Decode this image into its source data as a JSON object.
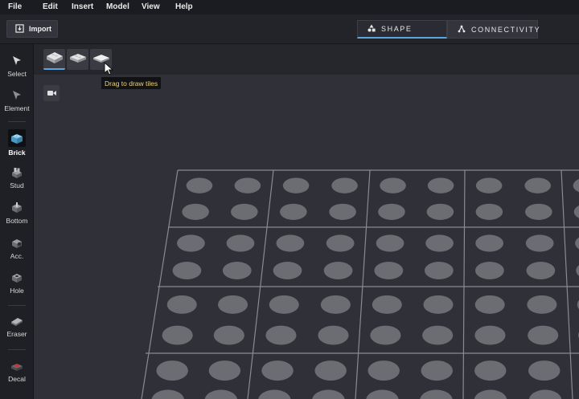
{
  "menu": [
    {
      "label": "File",
      "name": "menu-file"
    },
    {
      "label": "Edit",
      "name": "menu-edit"
    },
    {
      "label": "Insert",
      "name": "menu-insert"
    },
    {
      "label": "Model",
      "name": "menu-model"
    },
    {
      "label": "View",
      "name": "menu-view"
    },
    {
      "label": "Help",
      "name": "menu-help"
    }
  ],
  "toolbar": {
    "import_label": "Import",
    "tabs": [
      {
        "label": "SHAPE",
        "active": true,
        "icon": "shapes-icon"
      },
      {
        "label": "CONNECTIVITY",
        "active": false,
        "icon": "connectivity-icon"
      }
    ]
  },
  "tools": [
    {
      "label": "Select",
      "icon": "cursor-arrow-icon",
      "active": false
    },
    {
      "label": "Element",
      "icon": "element-arrow-icon",
      "active": false
    },
    {
      "label": "Brick",
      "icon": "brick-icon",
      "active": true
    },
    {
      "label": "Stud",
      "icon": "stud-icon",
      "active": false
    },
    {
      "label": "Bottom",
      "icon": "bottom-icon",
      "active": false
    },
    {
      "label": "Acc.",
      "icon": "accessory-icon",
      "active": false
    },
    {
      "label": "Hole",
      "icon": "hole-icon",
      "active": false
    },
    {
      "label": "Eraser",
      "icon": "eraser-icon",
      "active": false
    },
    {
      "label": "Decal",
      "icon": "decal-icon",
      "active": false
    }
  ],
  "brick_variants": [
    {
      "icon": "brick-variant-icon",
      "active": true
    },
    {
      "icon": "plate-variant-icon",
      "active": false
    },
    {
      "icon": "tile-variant-icon",
      "active": false
    }
  ],
  "tooltip": "Drag to draw tiles",
  "colors": {
    "accent": "#5aa7e0",
    "tooltip_text": "#f2d27a",
    "viewport_bg": "#2f3038",
    "stud": "#6c6d72",
    "grid_line": "#8a8b90"
  }
}
